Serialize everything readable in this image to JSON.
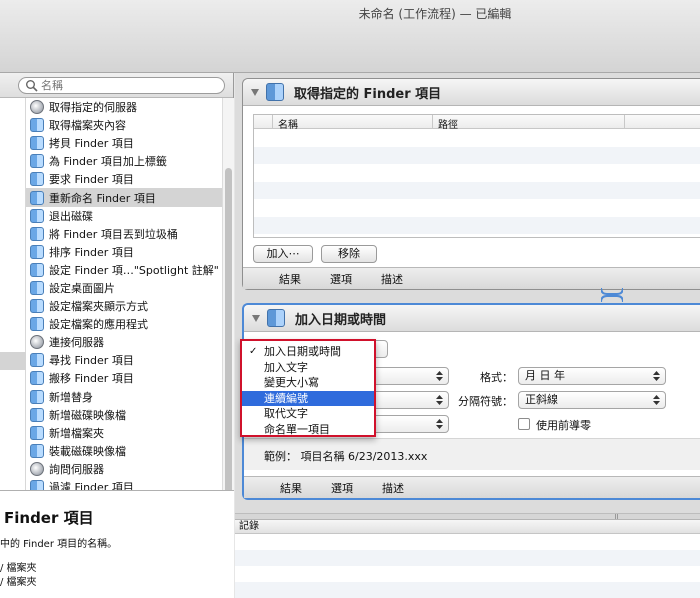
{
  "window": {
    "title": "未命名 (工作流程) — 已編輯"
  },
  "library": {
    "search_placeholder": "名稱",
    "actions": [
      {
        "label": "取得指定的伺服器",
        "icon": "globe-icon"
      },
      {
        "label": "取得檔案夾內容",
        "icon": "finder-icon"
      },
      {
        "label": "拷貝 Finder 項目",
        "icon": "finder-icon"
      },
      {
        "label": "為 Finder 項目加上標籤",
        "icon": "finder-icon"
      },
      {
        "label": "要求 Finder 項目",
        "icon": "finder-icon"
      },
      {
        "label": "重新命名 Finder 項目",
        "icon": "finder-icon",
        "selected": true
      },
      {
        "label": "退出磁碟",
        "icon": "finder-icon"
      },
      {
        "label": "將 Finder 項目丟到垃圾桶",
        "icon": "finder-icon"
      },
      {
        "label": "排序 Finder 項目",
        "icon": "finder-icon"
      },
      {
        "label": "設定 Finder 項…\"Spotlight 註解\"",
        "icon": "finder-icon"
      },
      {
        "label": "設定桌面圖片",
        "icon": "finder-icon"
      },
      {
        "label": "設定檔案夾顯示方式",
        "icon": "finder-icon"
      },
      {
        "label": "設定檔案的應用程式",
        "icon": "finder-icon"
      },
      {
        "label": "連接伺服器",
        "icon": "globe-icon"
      },
      {
        "label": "尋找 Finder 項目",
        "icon": "finder-icon"
      },
      {
        "label": "搬移 Finder 項目",
        "icon": "finder-icon"
      },
      {
        "label": "新增替身",
        "icon": "finder-icon"
      },
      {
        "label": "新增磁碟映像檔",
        "icon": "finder-icon"
      },
      {
        "label": "新增檔案夾",
        "icon": "finder-icon"
      },
      {
        "label": "裝載磁碟映像檔",
        "icon": "finder-icon"
      },
      {
        "label": "詢問伺服器",
        "icon": "globe-icon"
      },
      {
        "label": "過濾 Finder 項目",
        "icon": "finder-icon"
      }
    ],
    "description": {
      "title": "Finder 項目",
      "text": "中的 Finder 項目的名稱。",
      "input1": "/ 檔案夾",
      "input2": "/ 檔案夾",
      "rest": "-"
    }
  },
  "block1": {
    "title": "取得指定的 Finder 項目",
    "col_name": "名稱",
    "col_path": "路徑",
    "add_button": "加入⋯",
    "remove_button": "移除",
    "tabs": [
      "結果",
      "選項",
      "描述"
    ]
  },
  "block2": {
    "title": "加入日期或時間",
    "format_label": "格式：",
    "format_value": "月 日 年",
    "separator_label": "分隔符號：",
    "separator_value": "正斜線",
    "leading_zero_label": "使用前導零",
    "example": "範例：  項目名稱 6/23/2013.xxx",
    "tabs": [
      "結果",
      "選項",
      "描述"
    ],
    "menu": {
      "items": [
        "加入日期或時間",
        "加入文字",
        "變更大小寫",
        "連續編號",
        "取代文字",
        "命名單一項目"
      ],
      "checked_index": 0,
      "highlighted_index": 3
    }
  },
  "log": {
    "header": "記錄"
  },
  "colors": {
    "highlight": "#2f6bdc",
    "menu_border": "#d0112b",
    "block_focus": "#4d89d6"
  }
}
